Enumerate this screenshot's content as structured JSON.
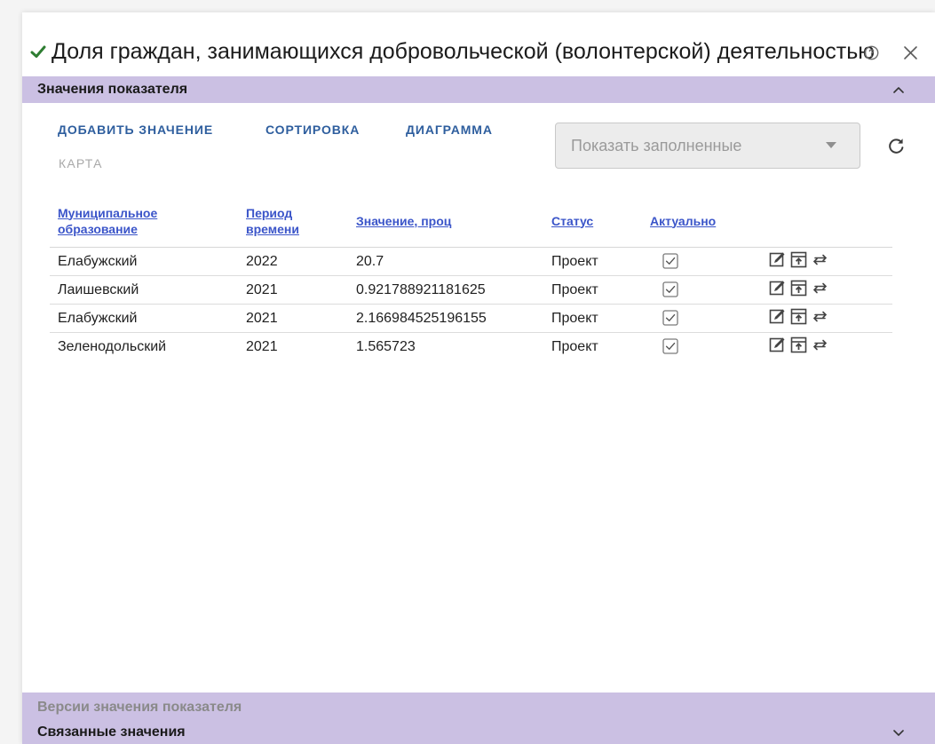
{
  "dialog": {
    "title": "Доля граждан, занимающихся добровольческой (волонтерской) деятельностью",
    "status_icon": "check-icon",
    "accent_color": "#cbc0e3"
  },
  "section": {
    "title": "Значения показателя",
    "expanded": true
  },
  "toolbar": {
    "add_label": "ДОБАВИТЬ ЗНАЧЕНИЕ",
    "sort_label": "СОРТИРОВКА",
    "chart_label": "ДИАГРАММА",
    "map_label": "КАРТА",
    "filter_placeholder": "Показать заполненные"
  },
  "table": {
    "columns": {
      "municipality": "Муниципальное образование",
      "period": "Период времени",
      "value": "Значение, проц",
      "status": "Статус",
      "actual": "Актуально"
    },
    "rows": [
      {
        "municipality": "Елабужский",
        "period": "2022",
        "value": "20.7",
        "status": "Проект",
        "actual": true
      },
      {
        "municipality": "Лаишевский",
        "period": "2021",
        "value": "0.921788921181625",
        "status": "Проект",
        "actual": true
      },
      {
        "municipality": "Елабужский",
        "period": "2021",
        "value": "2.166984525196155",
        "status": "Проект",
        "actual": true
      },
      {
        "municipality": "Зеленодольский",
        "period": "2021",
        "value": "1.565723",
        "status": "Проект",
        "actual": true
      }
    ]
  },
  "bottom": {
    "versions_label": "Версии значения показателя",
    "linked_label": "Связанные значения"
  }
}
